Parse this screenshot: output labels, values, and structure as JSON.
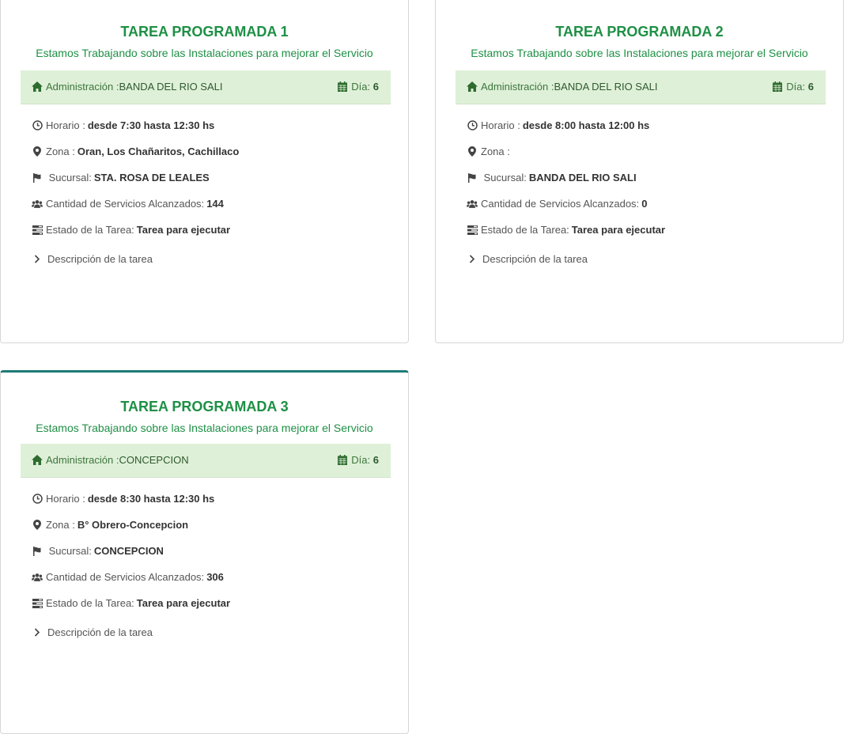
{
  "colors": {
    "title_green": "#1e9045",
    "band_bg": "#dff0d8",
    "band_text": "#3c763d",
    "card3_top_border": "#1d7a76"
  },
  "labels": {
    "subtitle": "Estamos Trabajando sobre las Instalaciones para mejorar el Servicio",
    "admin": "Administración :",
    "dia": "Día:",
    "horario": "Horario :",
    "zona": "Zona :",
    "sucursal": "Sucursal:",
    "cantidad": "Cantidad de Servicios Alcanzados:",
    "estado": "Estado de la Tarea:",
    "descripcion": "Descripción de la tarea"
  },
  "cards": [
    {
      "title": "TAREA PROGRAMADA 1",
      "admin": "BANDA DEL RIO SALI",
      "dia": "6",
      "horario": "desde 7:30 hasta 12:30 hs",
      "zona": "Oran, Los Chañaritos, Cachillaco",
      "sucursal": "STA. ROSA DE LEALES",
      "cantidad": "144",
      "estado": "Tarea para ejecutar"
    },
    {
      "title": "TAREA PROGRAMADA 2",
      "admin": "BANDA DEL RIO SALI",
      "dia": "6",
      "horario": "desde 8:00 hasta 12:00 hs",
      "zona": "",
      "sucursal": "BANDA DEL RIO SALI",
      "cantidad": "0",
      "estado": "Tarea para ejecutar"
    },
    {
      "title": "TAREA PROGRAMADA 3",
      "admin": "CONCEPCION",
      "dia": "6",
      "horario": "desde 8:30 hasta 12:30 hs",
      "zona": "B° Obrero-Concepcion",
      "sucursal": "CONCEPCION",
      "cantidad": "306",
      "estado": "Tarea para ejecutar"
    }
  ]
}
